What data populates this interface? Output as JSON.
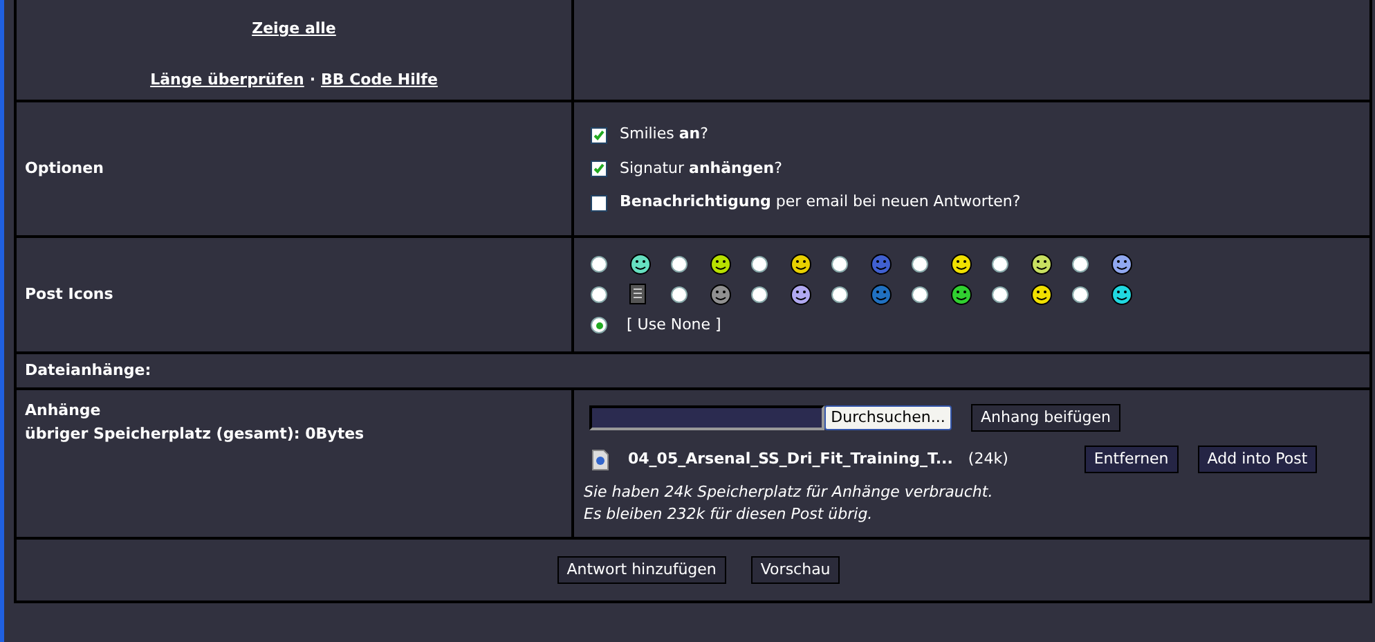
{
  "links": {
    "show_all": "Zeige alle",
    "check_length": "Länge überprüfen",
    "separator": "·",
    "bbcode_help": "BB Code Hilfe"
  },
  "options": {
    "label": "Optionen",
    "items": [
      {
        "text": "Smilies **an**?",
        "checked": true
      },
      {
        "text": "Signatur **anhängen**?",
        "checked": true
      },
      {
        "text": "**Benachrichtigung** per email bei neuen Antworten?",
        "checked": false
      }
    ]
  },
  "post_icons": {
    "label": "Post Icons",
    "icons": [
      {
        "selected": false
      },
      {
        "selected": false
      },
      {
        "selected": false
      },
      {
        "selected": false
      },
      {
        "selected": false
      },
      {
        "selected": false
      },
      {
        "selected": false
      },
      {
        "selected": false
      },
      {
        "selected": false
      },
      {
        "selected": false
      },
      {
        "selected": false
      },
      {
        "selected": false
      },
      {
        "selected": false
      },
      {
        "selected": false
      }
    ],
    "none": {
      "text": "[ Use None ]",
      "selected": true
    }
  },
  "attachments_header": "Dateianhänge:",
  "attachments": {
    "label": "Anhänge",
    "space": "übriger Speicherplatz (gesamt): 0Bytes",
    "browse": "Durchsuchen...",
    "add": "Anhang beifügen",
    "file": {
      "name": "04_05_Arsenal_SS_Dri_Fit_Training_T...",
      "size": "(24k)",
      "remove": "Entfernen",
      "insert": "Add into Post"
    },
    "notes": [
      "Sie haben 24k Speicherplatz für Anhänge verbraucht.",
      "Es bleiben 232k für diesen Post übrig."
    ]
  },
  "buttons": [
    "Antwort hinzufügen",
    "Vorschau"
  ]
}
